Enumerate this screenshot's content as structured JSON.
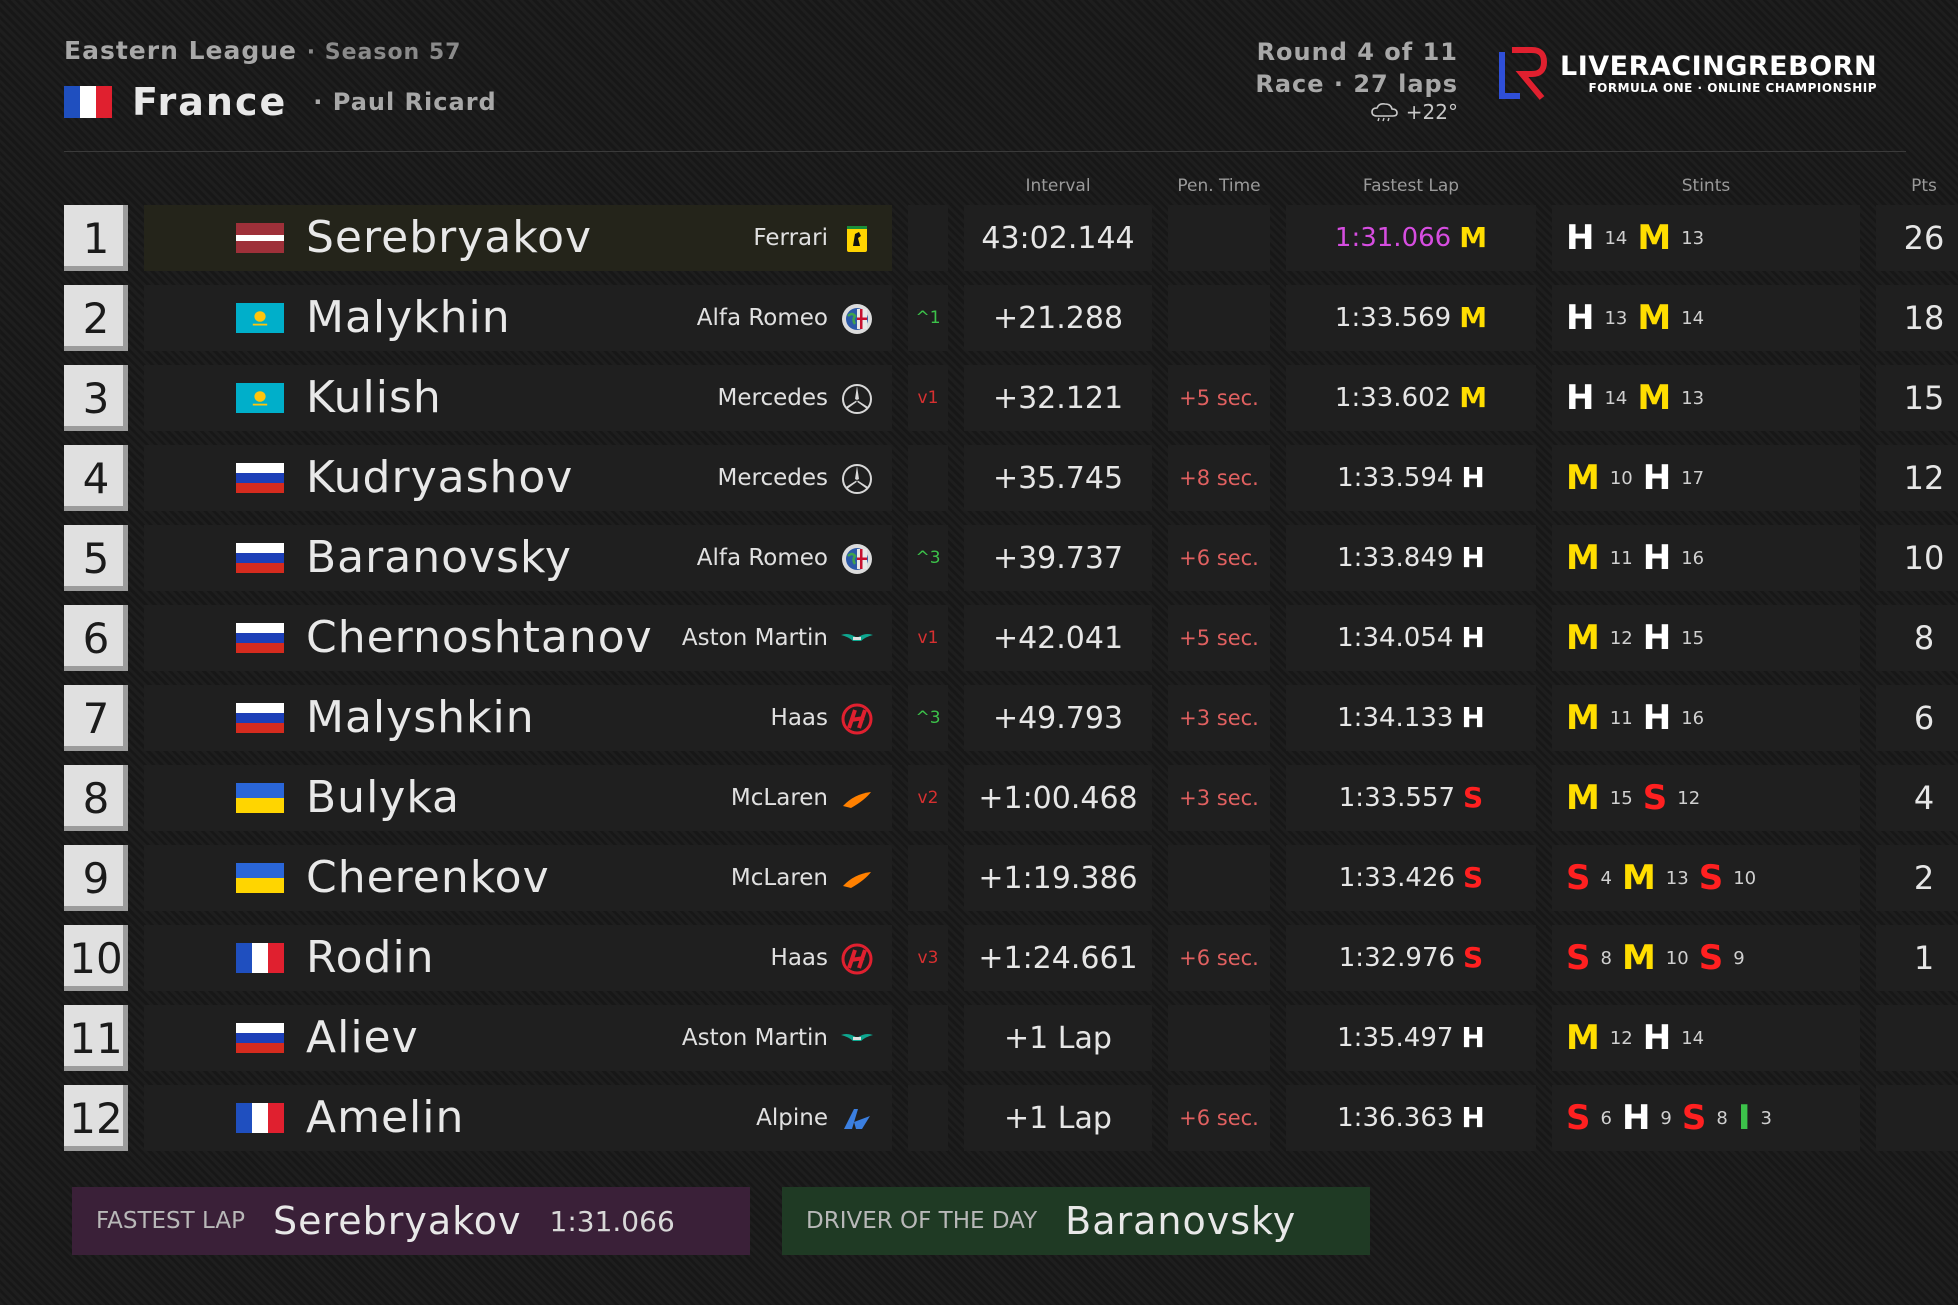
{
  "header": {
    "league": "Eastern League",
    "season": "Season 57",
    "country": "France",
    "track": "Paul Ricard",
    "round": "Round 4 of 11",
    "race": "Race · 27 laps",
    "weather": "+22°"
  },
  "logo": {
    "name": "LIVERACINGREBORN",
    "subtitle": "FORMULA ONE · ONLINE CHAMPIONSHIP"
  },
  "columns": {
    "interval": "Interval",
    "pen_time": "Pen. Time",
    "fastest_lap": "Fastest Lap",
    "stints": "Stints",
    "pts": "Pts"
  },
  "colors": {
    "soft": "#ff2020",
    "medium": "#ffdd00",
    "hard": "#ffffff",
    "intermediate": "#3cc24a",
    "fastest_lap": "#d64de0"
  },
  "rows": [
    {
      "pos": "1",
      "flag": "latvia",
      "driver": "Serebryakov",
      "team": "Ferrari",
      "team_icon": "ferrari-icon",
      "change": "",
      "interval": "43:02.144",
      "pen": "",
      "lap": "1:31.066",
      "lap_tyre": "M",
      "stints": [
        [
          "H",
          "14"
        ],
        [
          "M",
          "13"
        ]
      ],
      "pts": "26"
    },
    {
      "pos": "2",
      "flag": "kazakhstan",
      "driver": "Malykhin",
      "team": "Alfa Romeo",
      "team_icon": "alfa-romeo-icon",
      "change": "^1",
      "interval": "+21.288",
      "pen": "",
      "lap": "1:33.569",
      "lap_tyre": "M",
      "stints": [
        [
          "H",
          "13"
        ],
        [
          "M",
          "14"
        ]
      ],
      "pts": "18"
    },
    {
      "pos": "3",
      "flag": "kazakhstan",
      "driver": "Kulish",
      "team": "Mercedes",
      "team_icon": "mercedes-icon",
      "change": "v1",
      "interval": "+32.121",
      "pen": "+5 sec.",
      "lap": "1:33.602",
      "lap_tyre": "M",
      "stints": [
        [
          "H",
          "14"
        ],
        [
          "M",
          "13"
        ]
      ],
      "pts": "15"
    },
    {
      "pos": "4",
      "flag": "russia",
      "driver": "Kudryashov",
      "team": "Mercedes",
      "team_icon": "mercedes-icon",
      "change": "",
      "interval": "+35.745",
      "pen": "+8 sec.",
      "lap": "1:33.594",
      "lap_tyre": "H",
      "stints": [
        [
          "M",
          "10"
        ],
        [
          "H",
          "17"
        ]
      ],
      "pts": "12"
    },
    {
      "pos": "5",
      "flag": "russia",
      "driver": "Baranovsky",
      "team": "Alfa Romeo",
      "team_icon": "alfa-romeo-icon",
      "change": "^3",
      "interval": "+39.737",
      "pen": "+6 sec.",
      "lap": "1:33.849",
      "lap_tyre": "H",
      "stints": [
        [
          "M",
          "11"
        ],
        [
          "H",
          "16"
        ]
      ],
      "pts": "10"
    },
    {
      "pos": "6",
      "flag": "russia",
      "driver": "Chernoshtanov",
      "team": "Aston Martin",
      "team_icon": "aston-martin-icon",
      "change": "v1",
      "interval": "+42.041",
      "pen": "+5 sec.",
      "lap": "1:34.054",
      "lap_tyre": "H",
      "stints": [
        [
          "M",
          "12"
        ],
        [
          "H",
          "15"
        ]
      ],
      "pts": "8"
    },
    {
      "pos": "7",
      "flag": "russia",
      "driver": "Malyshkin",
      "team": "Haas",
      "team_icon": "haas-icon",
      "change": "^3",
      "interval": "+49.793",
      "pen": "+3 sec.",
      "lap": "1:34.133",
      "lap_tyre": "H",
      "stints": [
        [
          "M",
          "11"
        ],
        [
          "H",
          "16"
        ]
      ],
      "pts": "6"
    },
    {
      "pos": "8",
      "flag": "ukraine",
      "driver": "Bulyka",
      "team": "McLaren",
      "team_icon": "mclaren-icon",
      "change": "v2",
      "interval": "+1:00.468",
      "pen": "+3 sec.",
      "lap": "1:33.557",
      "lap_tyre": "S",
      "stints": [
        [
          "M",
          "15"
        ],
        [
          "S",
          "12"
        ]
      ],
      "pts": "4"
    },
    {
      "pos": "9",
      "flag": "ukraine",
      "driver": "Cherenkov",
      "team": "McLaren",
      "team_icon": "mclaren-icon",
      "change": "",
      "interval": "+1:19.386",
      "pen": "",
      "lap": "1:33.426",
      "lap_tyre": "S",
      "stints": [
        [
          "S",
          "4"
        ],
        [
          "M",
          "13"
        ],
        [
          "S",
          "10"
        ]
      ],
      "pts": "2"
    },
    {
      "pos": "10",
      "flag": "france",
      "driver": "Rodin",
      "team": "Haas",
      "team_icon": "haas-icon",
      "change": "v3",
      "interval": "+1:24.661",
      "pen": "+6 sec.",
      "lap": "1:32.976",
      "lap_tyre": "S",
      "stints": [
        [
          "S",
          "8"
        ],
        [
          "M",
          "10"
        ],
        [
          "S",
          "9"
        ]
      ],
      "pts": "1"
    },
    {
      "pos": "11",
      "flag": "russia",
      "driver": "Aliev",
      "team": "Aston Martin",
      "team_icon": "aston-martin-icon",
      "change": "",
      "interval": "+1 Lap",
      "pen": "",
      "lap": "1:35.497",
      "lap_tyre": "H",
      "stints": [
        [
          "M",
          "12"
        ],
        [
          "H",
          "14"
        ]
      ],
      "pts": ""
    },
    {
      "pos": "12",
      "flag": "france",
      "driver": "Amelin",
      "team": "Alpine",
      "team_icon": "alpine-icon",
      "change": "",
      "interval": "+1 Lap",
      "pen": "+6 sec.",
      "lap": "1:36.363",
      "lap_tyre": "H",
      "stints": [
        [
          "S",
          "6"
        ],
        [
          "H",
          "9"
        ],
        [
          "S",
          "8"
        ],
        [
          "I",
          "3"
        ]
      ],
      "pts": ""
    }
  ],
  "awards": {
    "fastest_lap_label": "FASTEST LAP",
    "fastest_lap_driver": "Serebryakov",
    "fastest_lap_time": "1:31.066",
    "dotd_label": "DRIVER OF THE DAY",
    "dotd_driver": "Baranovsky"
  }
}
